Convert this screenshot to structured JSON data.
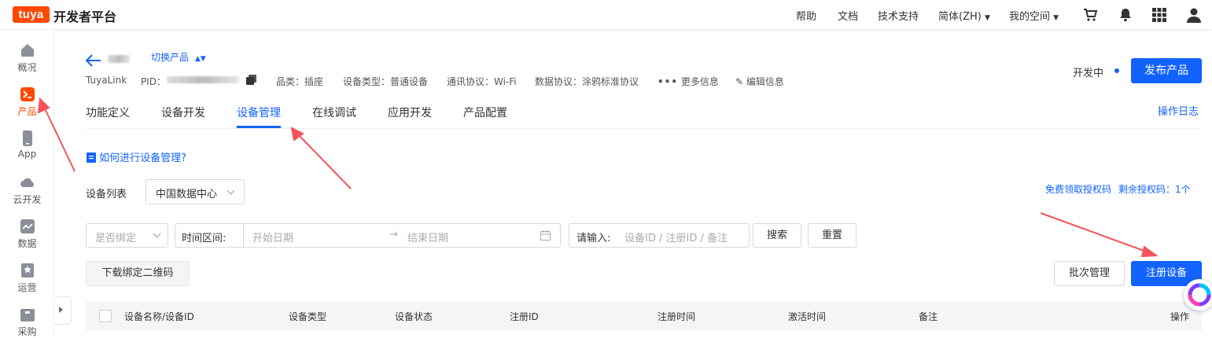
{
  "topbar": {
    "logo": "tuya",
    "brand": "开发者平台",
    "nav": [
      "帮助",
      "文档",
      "技术支持",
      "简体(ZH)",
      "我的空间"
    ],
    "icons": [
      "cart-icon",
      "bell-icon",
      "apps-grid-icon",
      "user-icon"
    ]
  },
  "sidebar": {
    "items": [
      {
        "label": "概况",
        "icon": "home-icon"
      },
      {
        "label": "产品",
        "icon": "terminal-icon",
        "active": true
      },
      {
        "label": "App",
        "icon": "phone-icon"
      },
      {
        "label": "云开发",
        "icon": "cloud-icon"
      },
      {
        "label": "数据",
        "icon": "chart-icon"
      },
      {
        "label": "运营",
        "icon": "bookmark-icon"
      },
      {
        "label": "采购",
        "icon": "box-icon"
      }
    ]
  },
  "header": {
    "switch_product": "切换产品",
    "meta": {
      "link_type": "TuyaLink",
      "pid_label": "PID：",
      "category": "品类：插座",
      "device_type": "设备类型：普通设备",
      "protocol": "通讯协议：Wi-Fi",
      "data_protocol": "数据协议：涂鸦标准协议",
      "more_info": "更多信息",
      "edit_info": "编辑信息"
    },
    "status": "开发中",
    "publish_button": "发布产品"
  },
  "tabs": {
    "items": [
      "功能定义",
      "设备开发",
      "设备管理",
      "在线调试",
      "应用开发",
      "产品配置"
    ],
    "active_index": 2,
    "operation_log": "操作日志"
  },
  "content": {
    "help_link": "如何进行设备管理?",
    "device_list_label": "设备列表",
    "datacenter_select": "中国数据中心",
    "free_auth_link": "免费领取授权码",
    "remaining_auth": "剩余授权码：1个",
    "filters": {
      "bind_placeholder": "是否绑定",
      "time_range_label": "时间区间:",
      "start_date_placeholder": "开始日期",
      "end_date_placeholder": "结束日期",
      "input_label": "请输入:",
      "input_placeholder": "设备ID / 注册ID / 备注",
      "search_button": "搜索",
      "reset_button": "重置"
    },
    "download_qr_button": "下载绑定二维码",
    "batch_manage_button": "批次管理",
    "register_device_button": "注册设备"
  },
  "table": {
    "columns": [
      "设备名称/设备ID",
      "设备类型",
      "设备状态",
      "注册ID",
      "注册时间",
      "激活时间",
      "备注",
      "操作"
    ]
  },
  "colors": {
    "primary": "#1262ff",
    "brand": "#ff4800",
    "annotation_arrow": "#f4545a"
  }
}
